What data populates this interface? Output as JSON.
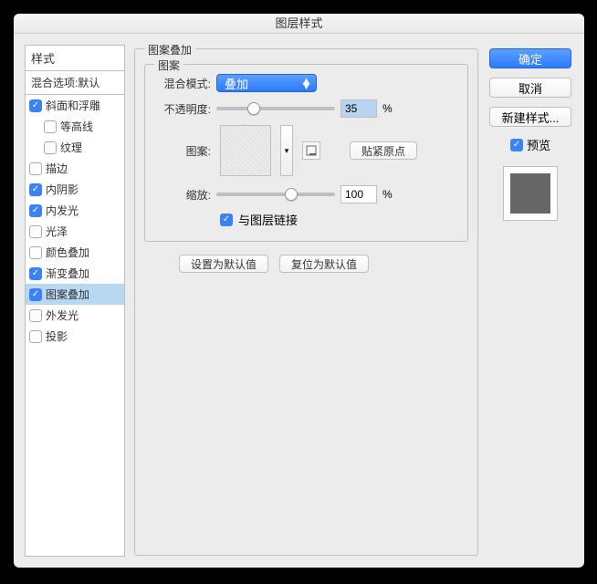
{
  "title": "图层样式",
  "left": {
    "styles_header": "样式",
    "blend_header": "混合选项:默认",
    "items": [
      {
        "label": "斜面和浮雕",
        "checked": true,
        "indent": false
      },
      {
        "label": "等高线",
        "checked": false,
        "indent": true
      },
      {
        "label": "纹理",
        "checked": false,
        "indent": true
      },
      {
        "label": "描边",
        "checked": false,
        "indent": false
      },
      {
        "label": "内阴影",
        "checked": true,
        "indent": false
      },
      {
        "label": "内发光",
        "checked": true,
        "indent": false
      },
      {
        "label": "光泽",
        "checked": false,
        "indent": false
      },
      {
        "label": "颜色叠加",
        "checked": false,
        "indent": false
      },
      {
        "label": "渐变叠加",
        "checked": true,
        "indent": false
      },
      {
        "label": "图案叠加",
        "checked": true,
        "indent": false,
        "selected": true
      },
      {
        "label": "外发光",
        "checked": false,
        "indent": false
      },
      {
        "label": "投影",
        "checked": false,
        "indent": false
      }
    ]
  },
  "main": {
    "section_title": "图案叠加",
    "group_title": "图案",
    "blend_mode_label": "混合模式:",
    "blend_mode_value": "叠加",
    "opacity_label": "不透明度:",
    "opacity_value": "35",
    "opacity_pct_pos": 26,
    "pattern_label": "图案:",
    "snap_origin": "贴紧原点",
    "scale_label": "缩放:",
    "scale_value": "100",
    "scale_pct_pos": 58,
    "link_label": "与图层链接",
    "link_checked": true,
    "default_set": "设置为默认值",
    "default_reset": "复位为默认值"
  },
  "right": {
    "ok": "确定",
    "cancel": "取消",
    "new_style": "新建样式...",
    "preview_label": "预览",
    "preview_checked": true
  }
}
